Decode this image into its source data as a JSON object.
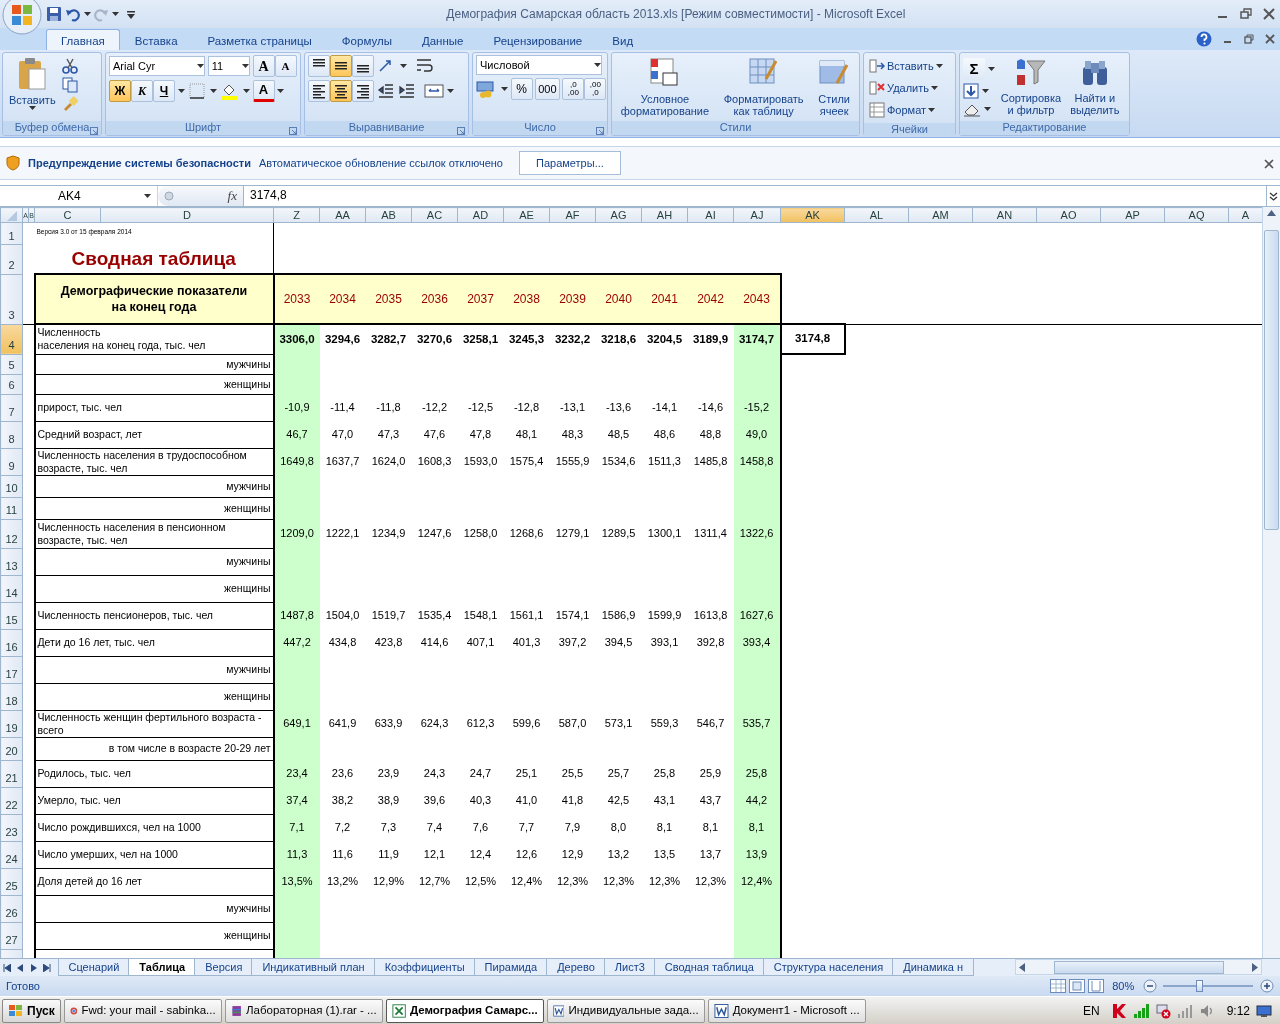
{
  "window": {
    "title": "Демография Самарская область 2013.xls  [Режим совместимости] - Microsoft Excel"
  },
  "ribbon_tabs": [
    {
      "label": "Главная",
      "selected": true
    },
    {
      "label": "Вставка",
      "selected": false
    },
    {
      "label": "Разметка страницы",
      "selected": false
    },
    {
      "label": "Формулы",
      "selected": false
    },
    {
      "label": "Данные",
      "selected": false
    },
    {
      "label": "Рецензирование",
      "selected": false
    },
    {
      "label": "Вид",
      "selected": false
    }
  ],
  "ribbon": {
    "group_labels": [
      "Буфер обмена",
      "Шрифт",
      "Выравнивание",
      "Число",
      "Стили",
      "Ячейки",
      "Редактирование"
    ],
    "paste": "Вставить",
    "font": {
      "name": "Arial Cyr",
      "size": "11",
      "grow": "A",
      "shrink": "A",
      "color_letter": "A",
      "style_buttons": [
        {
          "label": "Ж",
          "kind": "bold",
          "selected": true
        },
        {
          "label": "К",
          "kind": "italic",
          "selected": false
        },
        {
          "label": "Ч",
          "kind": "underline",
          "selected": false
        }
      ]
    },
    "alignment": {
      "vertical": [
        {
          "kind": "top",
          "selected": false
        },
        {
          "kind": "middle",
          "selected": true
        },
        {
          "kind": "bottom",
          "selected": false
        }
      ],
      "horizontal": [
        {
          "kind": "left",
          "selected": false
        },
        {
          "kind": "center",
          "selected": true
        },
        {
          "kind": "right",
          "selected": false
        }
      ]
    },
    "number": {
      "format": "Числовой",
      "percent": "%",
      "thousands": "000",
      "decimals": [
        {
          "top": ",0",
          "bottom": ",00"
        },
        {
          "top": ",00",
          "bottom": ",0"
        }
      ]
    },
    "styles": [
      "Условное\nформатирование",
      "Форматировать\nкак таблицу",
      "Стили\nячеек"
    ],
    "cells": [
      {
        "kind": "insert",
        "label": "Вставить"
      },
      {
        "kind": "delete",
        "label": "Удалить"
      },
      {
        "kind": "format",
        "label": "Формат"
      }
    ],
    "editing": {
      "sum": "Σ",
      "sort": "Сортировка\nи фильтр",
      "find": "Найти и\nвыделить"
    }
  },
  "security_bar": {
    "title": "Предупреждение системы безопасности",
    "message": "Автоматическое обновление ссылок отключено",
    "button": "Параметры..."
  },
  "formula_bar": {
    "name_box": "AK4",
    "function_label": "fx",
    "value": "3174,8"
  },
  "sheet": {
    "columns": [
      {
        "label": "A",
        "selected": false
      },
      {
        "label": "B",
        "selected": false
      },
      {
        "label": "C",
        "selected": false
      },
      {
        "label": "D",
        "selected": false
      },
      {
        "label": "Z",
        "selected": false
      },
      {
        "label": "AA",
        "selected": false
      },
      {
        "label": "AB",
        "selected": false
      },
      {
        "label": "AC",
        "selected": false
      },
      {
        "label": "AD",
        "selected": false
      },
      {
        "label": "AE",
        "selected": false
      },
      {
        "label": "AF",
        "selected": false
      },
      {
        "label": "AG",
        "selected": false
      },
      {
        "label": "AH",
        "selected": false
      },
      {
        "label": "AI",
        "selected": false
      },
      {
        "label": "AJ",
        "selected": false
      },
      {
        "label": "AK",
        "selected": true
      },
      {
        "label": "AL",
        "selected": false
      },
      {
        "label": "AM",
        "selected": false
      },
      {
        "label": "AN",
        "selected": false
      },
      {
        "label": "AO",
        "selected": false
      },
      {
        "label": "AP",
        "selected": false
      },
      {
        "label": "AQ",
        "selected": false
      },
      {
        "label": "A",
        "selected": false
      }
    ],
    "top_row_numbers": [
      "1",
      "2",
      "3"
    ],
    "version_note": "Версия 3.0 от 15 февраля 2014",
    "title": "Сводная таблица",
    "header_label": "Демографические показатели\nна конец года",
    "years": [
      {
        "label": "2033",
        "highlight": true
      },
      {
        "label": "2034",
        "highlight": false
      },
      {
        "label": "2035",
        "highlight": false
      },
      {
        "label": "2036",
        "highlight": false
      },
      {
        "label": "2037",
        "highlight": false
      },
      {
        "label": "2038",
        "highlight": false
      },
      {
        "label": "2039",
        "highlight": false
      },
      {
        "label": "2040",
        "highlight": false
      },
      {
        "label": "2041",
        "highlight": false
      },
      {
        "label": "2042",
        "highlight": false
      },
      {
        "label": "2043",
        "highlight": true
      }
    ],
    "rows": [
      {
        "number": "4",
        "kind": "total",
        "label": "Численность\nнаселения на конец года, тыс. чел",
        "values": [
          "3306,0",
          "3294,6",
          "3282,7",
          "3270,6",
          "3258,1",
          "3245,3",
          "3232,2",
          "3218,6",
          "3204,5",
          "3189,9",
          "3174,7"
        ],
        "selected_value": "3174,8"
      },
      {
        "number": "5",
        "kind": "sub",
        "label": "мужчины",
        "values": []
      },
      {
        "number": "6",
        "kind": "sub",
        "label": "женщины",
        "values": []
      },
      {
        "number": "7",
        "kind": "main",
        "label": "прирост, тыс. чел",
        "values": [
          "-10,9",
          "-11,4",
          "-11,8",
          "-12,2",
          "-12,5",
          "-12,8",
          "-13,1",
          "-13,6",
          "-14,1",
          "-14,6",
          "-15,2"
        ]
      },
      {
        "number": "8",
        "kind": "main",
        "label": "Средний возраст, лет",
        "values": [
          "46,7",
          "47,0",
          "47,3",
          "47,6",
          "47,8",
          "48,1",
          "48,3",
          "48,5",
          "48,6",
          "48,8",
          "49,0"
        ]
      },
      {
        "number": "9",
        "kind": "main",
        "label": "Численность населения в трудоспособном возрасте, тыс. чел",
        "values": [
          "1649,8",
          "1637,7",
          "1624,0",
          "1608,3",
          "1593,0",
          "1575,4",
          "1555,9",
          "1534,6",
          "1511,3",
          "1485,8",
          "1458,8"
        ]
      },
      {
        "number": "10",
        "kind": "sub",
        "label": "мужчины",
        "values": []
      },
      {
        "number": "11",
        "kind": "sub",
        "label": "женщины",
        "values": []
      },
      {
        "number": "12",
        "kind": "main",
        "label": "Численность населения в пенсионном возрасте, тыс. чел",
        "values": [
          "1209,0",
          "1222,1",
          "1234,9",
          "1247,6",
          "1258,0",
          "1268,6",
          "1279,1",
          "1289,5",
          "1300,1",
          "1311,4",
          "1322,6"
        ]
      },
      {
        "number": "13",
        "kind": "sub",
        "label": "мужчины",
        "values": []
      },
      {
        "number": "14",
        "kind": "sub",
        "label": "женщины",
        "values": []
      },
      {
        "number": "15",
        "kind": "main",
        "label": "Численность пенсионеров, тыс. чел",
        "values": [
          "1487,8",
          "1504,0",
          "1519,7",
          "1535,4",
          "1548,1",
          "1561,1",
          "1574,1",
          "1586,9",
          "1599,9",
          "1613,8",
          "1627,6"
        ]
      },
      {
        "number": "16",
        "kind": "main",
        "label": "Дети до 16 лет, тыс. чел",
        "values": [
          "447,2",
          "434,8",
          "423,8",
          "414,6",
          "407,1",
          "401,3",
          "397,2",
          "394,5",
          "393,1",
          "392,8",
          "393,4"
        ]
      },
      {
        "number": "17",
        "kind": "sub",
        "label": "мужчины",
        "values": []
      },
      {
        "number": "18",
        "kind": "sub",
        "label": "женщины",
        "values": []
      },
      {
        "number": "19",
        "kind": "main",
        "label": "Численность женщин фертильного возраста - всего",
        "values": [
          "649,1",
          "641,9",
          "633,9",
          "624,3",
          "612,3",
          "599,6",
          "587,0",
          "573,1",
          "559,3",
          "546,7",
          "535,7"
        ]
      },
      {
        "number": "20",
        "kind": "sub",
        "label": "в том числе в возрасте 20-29 лет",
        "values": []
      },
      {
        "number": "21",
        "kind": "main",
        "label": "Родилось, тыс. чел",
        "values": [
          "23,4",
          "23,6",
          "23,9",
          "24,3",
          "24,7",
          "25,1",
          "25,5",
          "25,7",
          "25,8",
          "25,9",
          "25,8"
        ]
      },
      {
        "number": "22",
        "kind": "main",
        "label": "Умерло, тыс. чел",
        "values": [
          "37,4",
          "38,2",
          "38,9",
          "39,6",
          "40,3",
          "41,0",
          "41,8",
          "42,5",
          "43,1",
          "43,7",
          "44,2"
        ]
      },
      {
        "number": "23",
        "kind": "main",
        "label": "Число рождившихся, чел на 1000",
        "values": [
          "7,1",
          "7,2",
          "7,3",
          "7,4",
          "7,6",
          "7,7",
          "7,9",
          "8,0",
          "8,1",
          "8,1",
          "8,1"
        ]
      },
      {
        "number": "24",
        "kind": "main",
        "label": "Число умерших, чел на 1000",
        "values": [
          "11,3",
          "11,6",
          "11,9",
          "12,1",
          "12,4",
          "12,6",
          "12,9",
          "13,2",
          "13,5",
          "13,7",
          "13,9"
        ]
      },
      {
        "number": "25",
        "kind": "main",
        "label": "Доля детей до 16 лет",
        "values": [
          "13,5%",
          "13,2%",
          "12,9%",
          "12,7%",
          "12,5%",
          "12,4%",
          "12,3%",
          "12,3%",
          "12,3%",
          "12,3%",
          "12,4%"
        ]
      },
      {
        "number": "26",
        "kind": "sub",
        "label": "мужчины",
        "values": []
      },
      {
        "number": "27",
        "kind": "sub",
        "label": "женщины",
        "values": []
      }
    ]
  },
  "sheet_tabs": [
    {
      "label": "Сценарий",
      "selected": false
    },
    {
      "label": "Таблица",
      "selected": true
    },
    {
      "label": "Версия",
      "selected": false
    },
    {
      "label": "Индикативный план",
      "selected": false
    },
    {
      "label": "Коэффициенты",
      "selected": false
    },
    {
      "label": "Пирамида",
      "selected": false
    },
    {
      "label": "Дерево",
      "selected": false
    },
    {
      "label": "Лист3",
      "selected": false
    },
    {
      "label": "Сводная таблица",
      "selected": false
    },
    {
      "label": "Структура населения",
      "selected": false
    },
    {
      "label": "Динамика н",
      "selected": false
    }
  ],
  "status_bar": {
    "text": "Готово",
    "zoom": "80%",
    "zoom_level": {
      "level": 0.4
    }
  },
  "taskbar": {
    "start": "Пуск",
    "items": [
      {
        "kind": "browser",
        "label": "Fwd: your mail - sabinka...",
        "selected": false
      },
      {
        "kind": "archive",
        "label": "Лабораторная (1).rar - ...",
        "selected": false
      },
      {
        "kind": "excel",
        "label": "Демография Самарс...",
        "selected": true
      },
      {
        "kind": "word",
        "label": "Индивидуальные зада...",
        "selected": false
      },
      {
        "kind": "word",
        "label": "Документ1 - Microsoft ...",
        "selected": false
      }
    ],
    "language": "EN",
    "clock": "9:12"
  }
}
